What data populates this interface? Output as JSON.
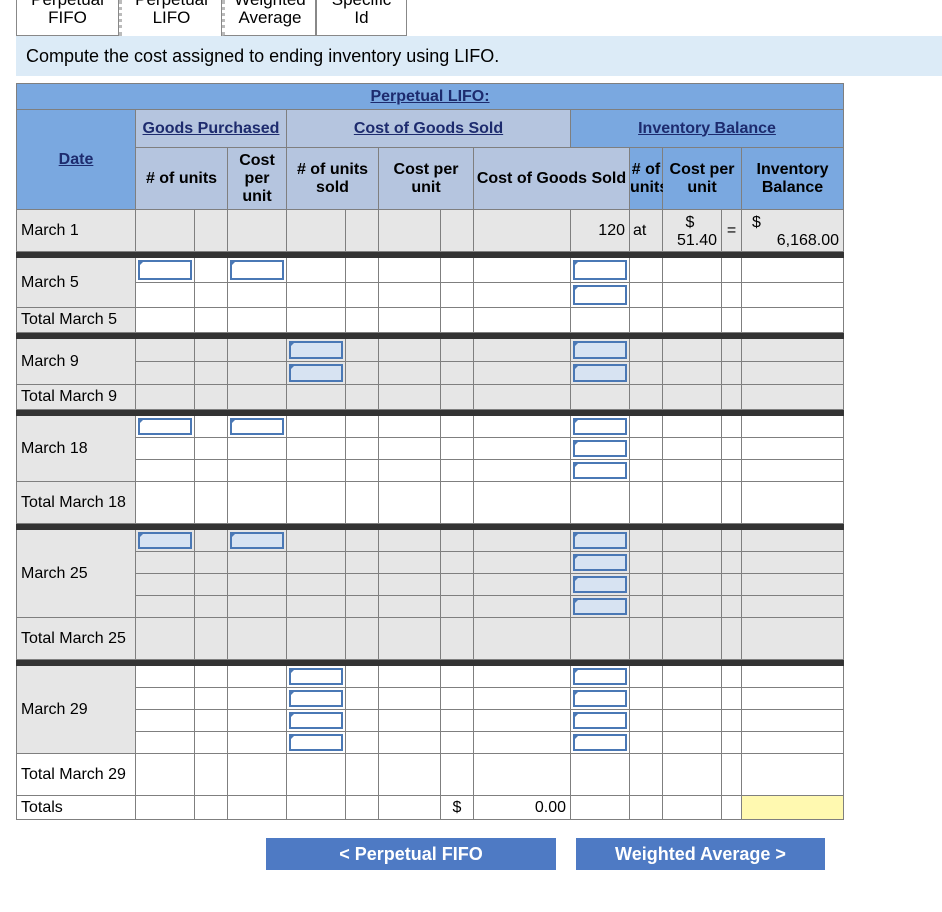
{
  "tabs": [
    {
      "top": "Perpetual",
      "bottom": "FIFO",
      "active": false
    },
    {
      "top": "Perpetual",
      "bottom": "LIFO",
      "active": true
    },
    {
      "top": "Weighted",
      "bottom": "Average",
      "active": false
    },
    {
      "top": "Specific",
      "bottom": "Id",
      "active": false
    }
  ],
  "instruction": "Compute the cost assigned to ending inventory using LIFO.",
  "table": {
    "title": "Perpetual LIFO:",
    "group_purchased": "Goods Purchased",
    "group_cogs": "Cost of Goods Sold",
    "group_balance": "Inventory Balance",
    "col_date": "Date",
    "col_units": "# of units",
    "col_cost_per_unit": "Cost per unit",
    "col_units_sold": "# of units sold",
    "col_cogs": "Cost of Goods Sold",
    "col_inv_balance": "Inventory Balance",
    "rows": {
      "march1": {
        "date": "March 1",
        "units": "120",
        "at": "at",
        "dollar": "$",
        "cost": "51.40",
        "eq": "=",
        "balance_dollar": "$",
        "balance": "6,168.00"
      },
      "march5": "March 5",
      "total_march5": "Total March 5",
      "march9": "March 9",
      "total_march9": "Total March 9",
      "march18": "March 18",
      "total_march18": "Total March 18",
      "march25": "March 25",
      "total_march25": "Total March 25",
      "march29": "March 29",
      "total_march29": "Total March 29",
      "totals": "Totals",
      "totals_dollar": "$",
      "totals_cogs": "0.00"
    }
  },
  "buttons": {
    "prev": "< Perpetual FIFO",
    "next": "Weighted Average >"
  }
}
